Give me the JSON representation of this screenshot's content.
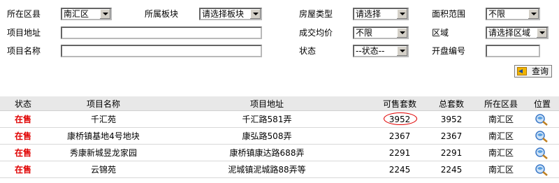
{
  "filters": {
    "district_label": "所在区县",
    "district_value": "南汇区",
    "sector_label": "所属板块",
    "sector_value": "请选择板块",
    "house_type_label": "房屋类型",
    "house_type_value": "请选择",
    "area_label": "面积范围",
    "area_value": "不限",
    "address_label": "项目地址",
    "avg_price_label": "成交均价",
    "avg_price_value": "不限",
    "region_label": "区域",
    "region_value": "请选择区域",
    "name_label": "项目名称",
    "status_label": "状态",
    "status_value": "--状态--",
    "open_no_label": "开盘编号",
    "search_button": "查询"
  },
  "table": {
    "headers": [
      "状态",
      "项目名称",
      "项目地址",
      "可售套数",
      "总套数",
      "所在区县",
      "位置"
    ],
    "rows": [
      {
        "status": "在售",
        "name": "千汇苑",
        "address": "千汇路581弄",
        "available": "3952",
        "total": "3952",
        "district": "南汇区"
      },
      {
        "status": "在售",
        "name": "康桥镇基地4号地块",
        "address": "康弘路508弄",
        "available": "2367",
        "total": "2367",
        "district": "南汇区"
      },
      {
        "status": "在售",
        "name": "秀康新城昱龙家园",
        "address": "康桥镇康达路688弄",
        "available": "2291",
        "total": "2291",
        "district": "南汇区"
      },
      {
        "status": "在售",
        "name": "云锦苑",
        "address": "泥城镇泥城路88弄等",
        "available": "2245",
        "total": "2245",
        "district": "南汇区"
      }
    ]
  },
  "icons": {
    "location": "magnifier-globe-icon",
    "search": "arrow-icon"
  },
  "colors": {
    "status_red": "#e00000",
    "header_bg": "#e8e8e8",
    "annotation_circle": "#e00000"
  }
}
